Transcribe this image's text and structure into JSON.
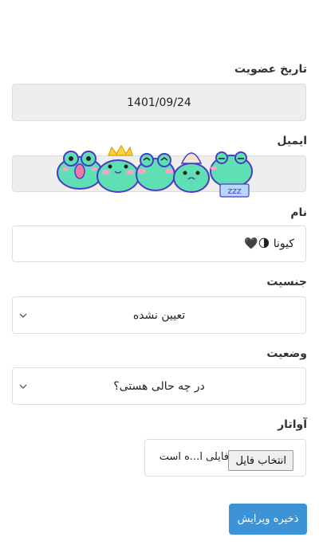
{
  "form": {
    "join_date_label": "تاریخ عضویت",
    "join_date_value": "1401/09/24",
    "email_label": "ایمیل",
    "email_value": "",
    "name_label": "نام",
    "name_value": "کیونا 🌗🖤",
    "gender_label": "جنسیت",
    "gender_value": "تعیین نشده",
    "status_label": "وضعیت",
    "status_value": "در چه حالی هستی؟",
    "avatar_label": "آواتار",
    "file_button": "انتخاب فایل",
    "file_text": "فایلی ا...ه است",
    "save_button": "ذخیره ویرایش"
  },
  "sticker": {
    "zzz": "zzz"
  },
  "colors": {
    "accent": "#3c93d5",
    "frog": "#5fe0b4",
    "frog_outline": "#4a3bc4",
    "blush": "#f3a6c6"
  },
  "icons": {
    "select_arrow": "chevron-down-icon"
  }
}
